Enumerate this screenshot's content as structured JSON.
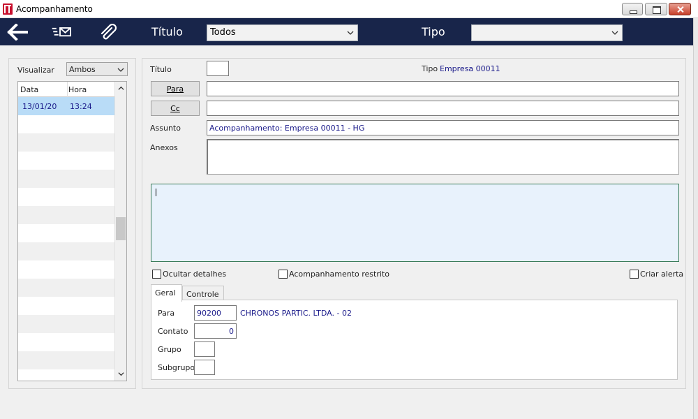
{
  "window": {
    "title": "Acompanhamento"
  },
  "toolbar": {
    "titulo_label": "Título",
    "titulo_value": "Todos",
    "tipo_label": "Tipo",
    "tipo_value": ""
  },
  "left": {
    "visualizar_label": "Visualizar",
    "visualizar_value": "Ambos",
    "columns": [
      "Data",
      "Hora"
    ],
    "rows": [
      {
        "data": "13/01/20",
        "hora": "13:24"
      }
    ]
  },
  "form": {
    "titulo_label": "Título",
    "titulo_value": "",
    "tipo_label": "Tipo",
    "tipo_value": "Empresa 00011",
    "para_button": "Para",
    "para_value": "",
    "cc_button": "Cc",
    "cc_value": "",
    "assunto_label": "Assunto",
    "assunto_value": "Acompanhamento: Empresa 00011 - HG",
    "anexos_label": "Anexos",
    "ocultar_label": "Ocultar detalhes",
    "restrito_label": "Acompanhamento restrito",
    "alerta_label": "Criar alerta"
  },
  "tabs": [
    {
      "label": "Geral",
      "active": true
    },
    {
      "label": "Controle",
      "active": false
    }
  ],
  "geral": {
    "para_label": "Para",
    "para_code": "90200",
    "para_name": "CHRONOS PARTIC. LTDA. - 02",
    "contato_label": "Contato",
    "contato_value": "0",
    "grupo_label": "Grupo",
    "grupo_value": "",
    "subgrupo_label": "Subgrupo",
    "subgrupo_value": ""
  },
  "colors": {
    "toolbar_bg": "#18254a",
    "selected_row": "#b9dcf7",
    "value_text": "#1a1a8a"
  }
}
